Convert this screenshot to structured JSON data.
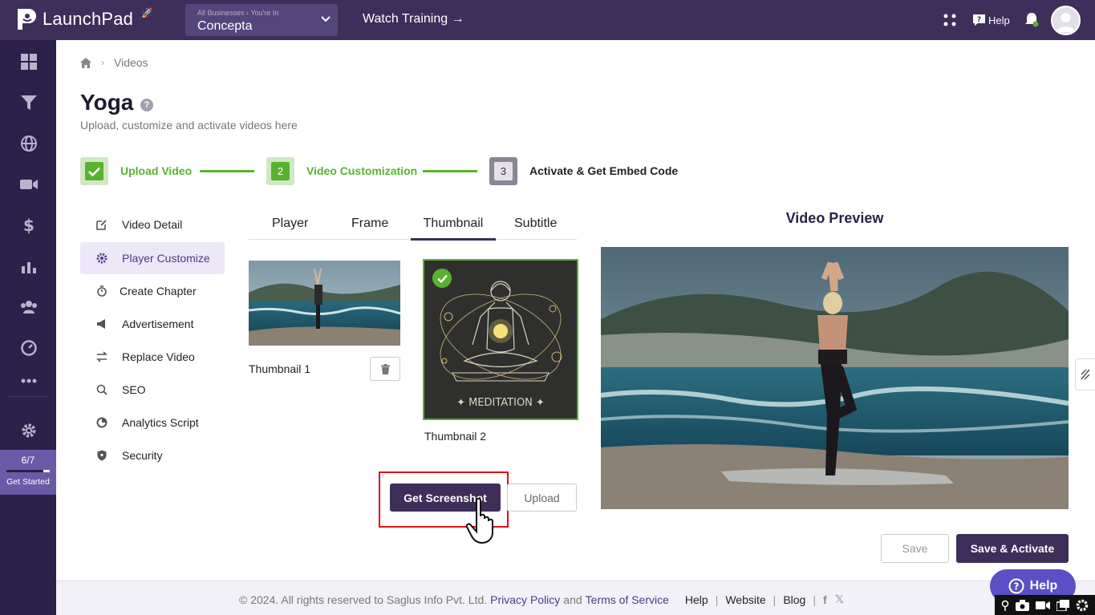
{
  "topbar": {
    "logo_text": "LaunchPad",
    "business_crumb": "All Businesses › You're In",
    "business_name": "Concepta",
    "watch_training": "Watch Training →",
    "help_label": "Help"
  },
  "sidebar": {
    "icons": [
      "dashboard-icon",
      "funnel-icon",
      "globe-icon",
      "video-icon",
      "dollar-icon",
      "analytics-icon",
      "users-icon",
      "gauge-icon",
      "more-icon",
      "settings-icon"
    ],
    "progress": {
      "count": "6/7",
      "label": "Get Started",
      "fraction": 0.857
    }
  },
  "breadcrumb": {
    "current": "Videos"
  },
  "page": {
    "title": "Yoga",
    "subtitle": "Upload, customize and activate videos here"
  },
  "steps": [
    {
      "number": "1",
      "label": "Upload Video",
      "state": "done"
    },
    {
      "number": "2",
      "label": "Video Customization",
      "state": "active"
    },
    {
      "number": "3",
      "label": "Activate & Get Embed Code",
      "state": "pending"
    }
  ],
  "menu": [
    {
      "label": "Video Detail",
      "icon": "edit-icon"
    },
    {
      "label": "Player Customize",
      "icon": "cog-icon",
      "active": true
    },
    {
      "label": "Create Chapter",
      "icon": "stopwatch-icon"
    },
    {
      "label": "Advertisement",
      "icon": "megaphone-icon"
    },
    {
      "label": "Replace Video",
      "icon": "swap-icon"
    },
    {
      "label": "SEO",
      "icon": "search-icon"
    },
    {
      "label": "Analytics Script",
      "icon": "pie-icon"
    },
    {
      "label": "Security",
      "icon": "shield-icon"
    }
  ],
  "tabs": [
    {
      "label": "Player"
    },
    {
      "label": "Frame"
    },
    {
      "label": "Thumbnail",
      "active": true
    },
    {
      "label": "Subtitle"
    }
  ],
  "thumbnails": [
    {
      "label": "Thumbnail 1"
    },
    {
      "label": "Thumbnail 2",
      "selected": true,
      "art_text": "✦ MEDITATION ✦"
    }
  ],
  "actions": {
    "get_screenshot": "Get Screenshot",
    "upload": "Upload",
    "save": "Save",
    "save_activate": "Save & Activate"
  },
  "preview": {
    "title": "Video Preview"
  },
  "footer": {
    "copyright": "©  2024. All rights reserved to Saglus Info Pvt. Ltd.",
    "privacy": "Privacy Policy",
    "and": "and",
    "terms": "Terms of Service",
    "help": "Help",
    "website": "Website",
    "blog": "Blog"
  },
  "help_widget": {
    "label": "Help"
  },
  "colors": {
    "brand": "#3d2e5a",
    "sidebar": "#2c2148",
    "success": "#58b22f",
    "highlight": "#e01010"
  }
}
